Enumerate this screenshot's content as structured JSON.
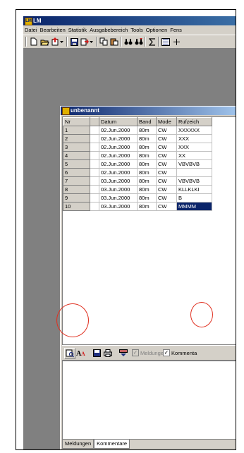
{
  "app": {
    "title": "LM",
    "menu": [
      "Datei",
      "Bearbeiten",
      "Statistik",
      "Ausgabebereich",
      "Tools",
      "Optionen",
      "Fens"
    ]
  },
  "child_window": {
    "title": "unbenannt",
    "columns": [
      "Nr",
      "",
      "Datum",
      "Band",
      "Mode",
      "Rufzeich"
    ],
    "rows": [
      [
        "1",
        "",
        "02.Jun.2000",
        "80m",
        "CW",
        "XXXXXX"
      ],
      [
        "2",
        "",
        "02.Jun.2000",
        "80m",
        "CW",
        "XXX"
      ],
      [
        "3",
        "",
        "02.Jun.2000",
        "80m",
        "CW",
        "XXX"
      ],
      [
        "4",
        "",
        "02.Jun.2000",
        "80m",
        "CW",
        "XX"
      ],
      [
        "5",
        "",
        "02.Jun.2000",
        "80m",
        "CW",
        "VBVBVB"
      ],
      [
        "6",
        "",
        "02.Jun.2000",
        "80m",
        "CW",
        ""
      ],
      [
        "7",
        "",
        "03.Jun.2000",
        "80m",
        "CW",
        "VBVBVB"
      ],
      [
        "8",
        "",
        "03.Jun.2000",
        "80m",
        "CW",
        "KLLKLKI"
      ],
      [
        "9",
        "",
        "03.Jun.2000",
        "80m",
        "CW",
        "B"
      ],
      [
        "10",
        "",
        "03.Jun.2000",
        "80m",
        "CW",
        "MMMM"
      ]
    ],
    "checkboxes": {
      "meldungen": {
        "label": "Meldungen",
        "checked": true,
        "disabled": true
      },
      "kommentare": {
        "label": "Kommenta",
        "checked": true,
        "disabled": false
      }
    },
    "tabs": [
      "Meldungen",
      "Kommentare"
    ],
    "active_tab": "Kommentare"
  },
  "colors": {
    "title_active": "#0a246a",
    "face": "#d4d0c8",
    "annotation_circle": "#e03020"
  }
}
